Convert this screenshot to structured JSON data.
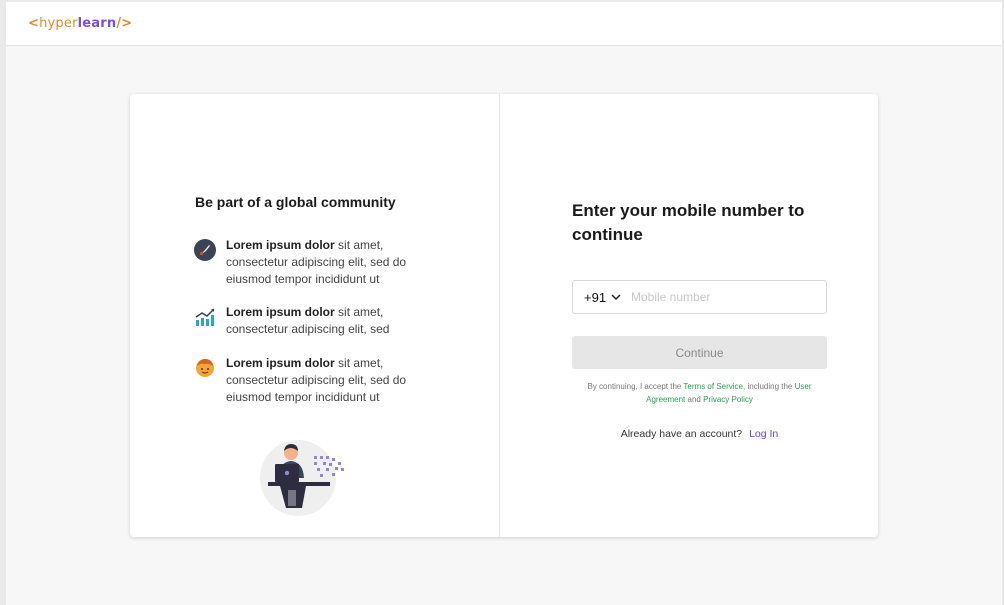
{
  "header": {
    "logo": {
      "open": "<",
      "hyper": "hyper",
      "learn": "learn",
      "close": "/>"
    }
  },
  "left_panel": {
    "title": "Be part of a global community",
    "features": [
      {
        "icon": "rocket-icon",
        "bold": "Lorem ipsum dolor",
        "rest": " sit amet, consectetur adipiscing elit, sed do eiusmod tempor incididunt ut"
      },
      {
        "icon": "growth-chart-icon",
        "bold": "Lorem ipsum dolor",
        "rest": " sit amet, consectetur adipiscing elit, sed"
      },
      {
        "icon": "person-emoji-icon",
        "bold": "Lorem ipsum dolor",
        "rest": " sit amet, consectetur adipiscing elit, sed do eiusmod tempor incididunt ut"
      }
    ]
  },
  "right_panel": {
    "title": "Enter your mobile number to continue",
    "country_code": "+91",
    "phone_placeholder": "Mobile number",
    "phone_value": "",
    "continue_label": "Continue",
    "terms": {
      "prefix": "By continuing, I accept the ",
      "tos": "Terms of Service",
      "mid1": ", including the ",
      "ua": "User Agreement",
      "mid2": " and ",
      "pp": "Privacy Policy"
    },
    "login": {
      "question": "Already have an account?",
      "link": "Log In"
    }
  },
  "colors": {
    "brand_orange": "#e28a2f",
    "brand_purple": "#7b4fd6",
    "link_green": "#2e9b4f",
    "login_purple": "#6b47c9",
    "button_disabled_bg": "#e6e6e6"
  }
}
